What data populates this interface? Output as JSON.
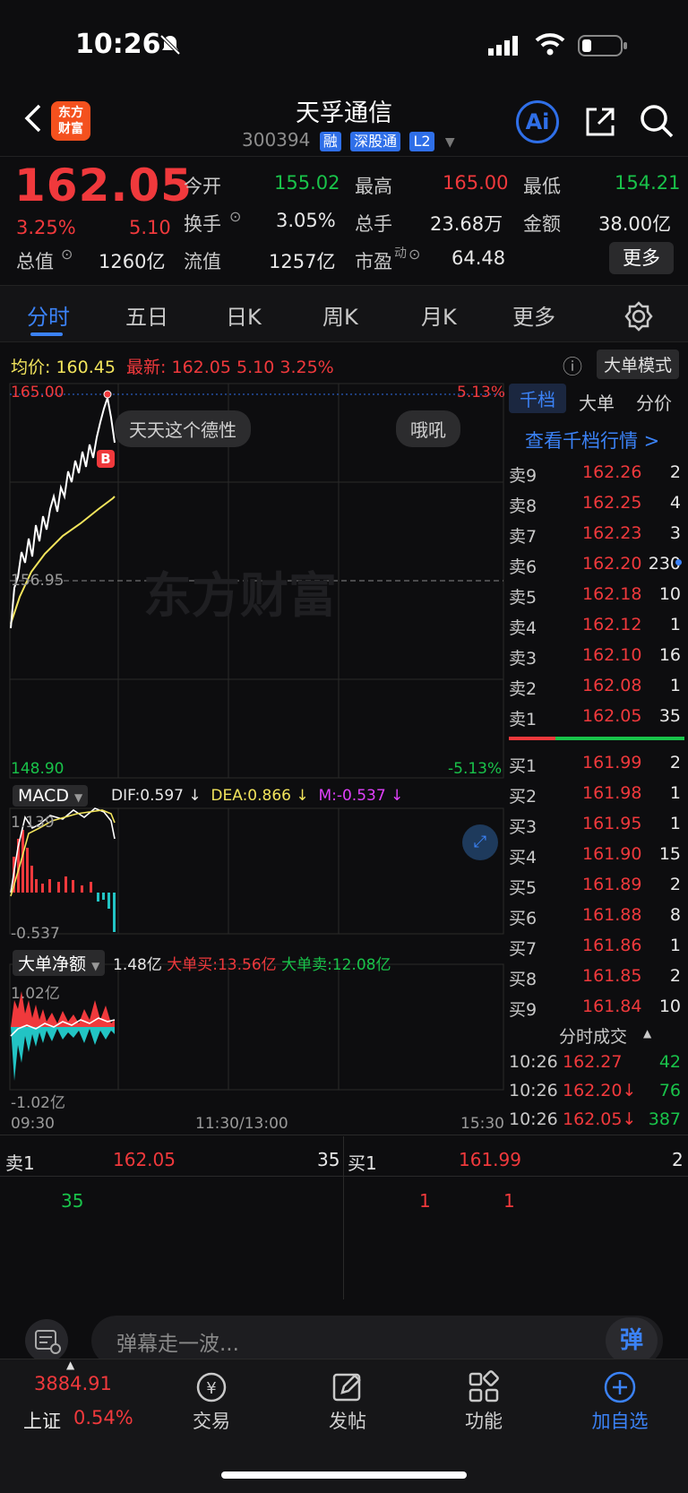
{
  "status": {
    "time": "10:26"
  },
  "header": {
    "title": "天孚通信",
    "code": "300394",
    "tags": [
      "融",
      "深股通",
      "L2"
    ],
    "logo_text": "东方财富",
    "ai_label": "Ai"
  },
  "quote": {
    "price": "162.05",
    "change_pct": "3.25%",
    "change": "5.10",
    "stats": [
      {
        "label": "今开",
        "value": "155.02",
        "color": "green"
      },
      {
        "label": "最高",
        "value": "165.00",
        "color": "red"
      },
      {
        "label": "最低",
        "value": "154.21",
        "color": "green"
      },
      {
        "label": "换手",
        "value": "3.05%",
        "color": "white"
      },
      {
        "label": "总手",
        "value": "23.68万",
        "color": "white"
      },
      {
        "label": "金额",
        "value": "38.00亿",
        "color": "white"
      },
      {
        "label": "总值",
        "value": "1260亿",
        "color": "white"
      },
      {
        "label": "流值",
        "value": "1257亿",
        "color": "white"
      },
      {
        "label": "市盈",
        "value": "64.48",
        "color": "white"
      }
    ],
    "more_label": "更多",
    "pe_sup": "动"
  },
  "tabs": [
    "分时",
    "五日",
    "日K",
    "周K",
    "月K",
    "更多"
  ],
  "intraday": {
    "avg_label": "均价:",
    "avg_value": "160.45",
    "latest_label": "最新:",
    "latest_value": "162.05",
    "latest_change": "5.10",
    "latest_pct": "3.25%",
    "big_order_mode": "大单模式",
    "y_top": "165.00",
    "y_mid": "156.95",
    "y_bottom": "148.90",
    "pct_top": "5.13%",
    "pct_bottom": "-5.13%",
    "watermark": "东方财富",
    "bubbles": [
      "天天这个德性",
      "哦吼"
    ],
    "b_marker": "B"
  },
  "macd": {
    "label": "MACD",
    "dif": "DIF:0.597 ↓",
    "dea": "DEA:0.866 ↓",
    "m": "M:-0.537 ↓",
    "top": "1.139",
    "bottom": "-0.537"
  },
  "big_order": {
    "label": "大单净额",
    "net": "1.48亿",
    "buy": "大单买:13.56亿",
    "sell": "大单卖:12.08亿",
    "top": "1.02亿",
    "bottom": "-1.02亿"
  },
  "time_axis": [
    "09:30",
    "11:30/13:00",
    "15:30"
  ],
  "order_book": {
    "tabs": [
      "千档",
      "大单",
      "分价"
    ],
    "link": "查看千档行情 >",
    "asks": [
      {
        "label": "卖9",
        "price": "162.26",
        "vol": "2"
      },
      {
        "label": "卖8",
        "price": "162.25",
        "vol": "4"
      },
      {
        "label": "卖7",
        "price": "162.23",
        "vol": "3"
      },
      {
        "label": "卖6",
        "price": "162.20",
        "vol": "230"
      },
      {
        "label": "卖5",
        "price": "162.18",
        "vol": "10"
      },
      {
        "label": "卖4",
        "price": "162.12",
        "vol": "1"
      },
      {
        "label": "卖3",
        "price": "162.10",
        "vol": "16"
      },
      {
        "label": "卖2",
        "price": "162.08",
        "vol": "1"
      },
      {
        "label": "卖1",
        "price": "162.05",
        "vol": "35"
      }
    ],
    "bids": [
      {
        "label": "买1",
        "price": "161.99",
        "vol": "2"
      },
      {
        "label": "买2",
        "price": "161.98",
        "vol": "1"
      },
      {
        "label": "买3",
        "price": "161.95",
        "vol": "1"
      },
      {
        "label": "买4",
        "price": "161.90",
        "vol": "15"
      },
      {
        "label": "买5",
        "price": "161.89",
        "vol": "2"
      },
      {
        "label": "买6",
        "price": "161.88",
        "vol": "8"
      },
      {
        "label": "买7",
        "price": "161.86",
        "vol": "1"
      },
      {
        "label": "买8",
        "price": "161.85",
        "vol": "2"
      },
      {
        "label": "买9",
        "price": "161.84",
        "vol": "10"
      }
    ],
    "ticks_title": "分时成交",
    "ticks": [
      {
        "time": "10:26",
        "price": "162.27",
        "vol": "42",
        "arrow": ""
      },
      {
        "time": "10:26",
        "price": "162.20↓",
        "vol": "76",
        "arrow": "down"
      },
      {
        "time": "10:26",
        "price": "162.05↓",
        "vol": "387",
        "arrow": "down"
      }
    ]
  },
  "strip": {
    "ask_label": "卖1",
    "ask_price": "162.05",
    "ask_vol": "35",
    "bid_label": "买1",
    "bid_price": "161.99",
    "bid_vol": "2",
    "ask_queue": [
      "35"
    ],
    "bid_queue": [
      "1",
      "1"
    ]
  },
  "input": {
    "placeholder": "弹幕走一波...",
    "send_label": "弹"
  },
  "nav": {
    "index_value": "3884.91",
    "index_name": "上证",
    "index_pct": "0.54%",
    "items": [
      "交易",
      "发帖",
      "功能",
      "加自选"
    ]
  },
  "colors": {
    "red": "#f0393c",
    "green": "#19c34a",
    "blue": "#3b82f6",
    "yellow": "#f2e45c"
  }
}
